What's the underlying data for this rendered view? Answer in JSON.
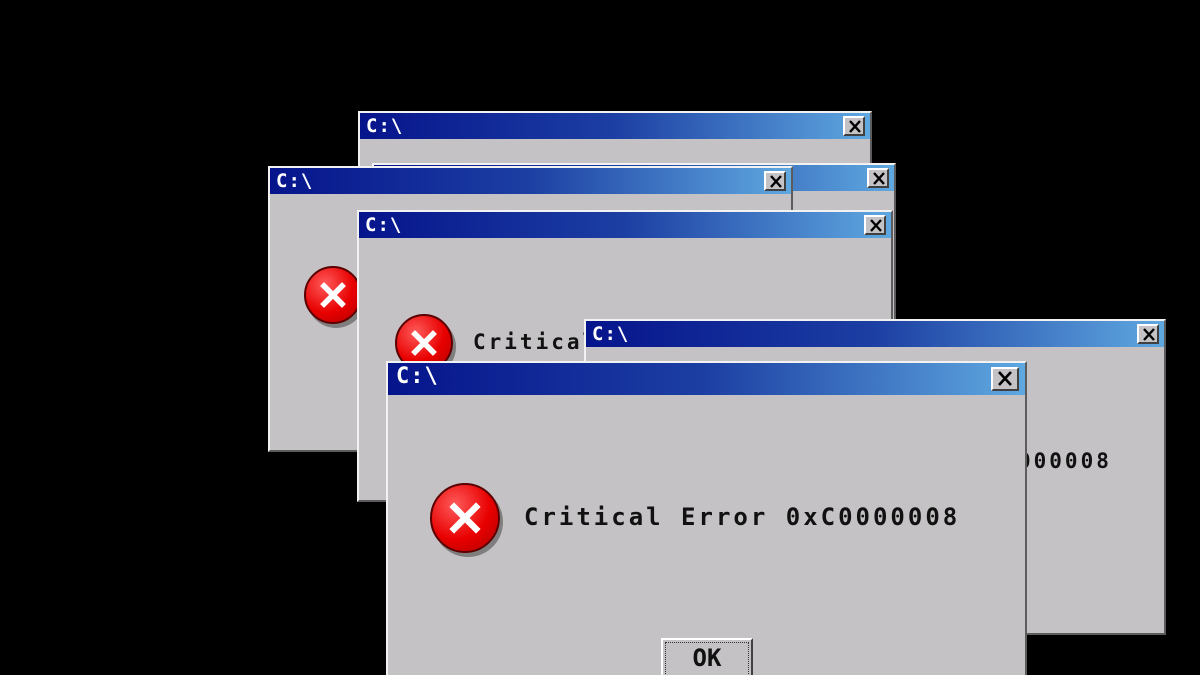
{
  "colors": {
    "desktop_background": "#000000",
    "dialog_face": "#c4c2c4",
    "titlebar_start": "#06148c",
    "titlebar_end": "#5fa8e0",
    "error_red": "#e80000"
  },
  "icons": {
    "close": "close-icon",
    "error": "error-icon"
  },
  "dialogs": [
    {
      "title": "C:\\",
      "message": ""
    },
    {
      "title": "",
      "message": ""
    },
    {
      "title": "C:\\",
      "message": ""
    },
    {
      "title": "C:\\",
      "message": "Critical"
    },
    {
      "title": "C:\\",
      "message": "000008"
    },
    {
      "title": "C:\\",
      "message": "Critical Error 0xC0000008",
      "ok_label": "OK"
    }
  ]
}
